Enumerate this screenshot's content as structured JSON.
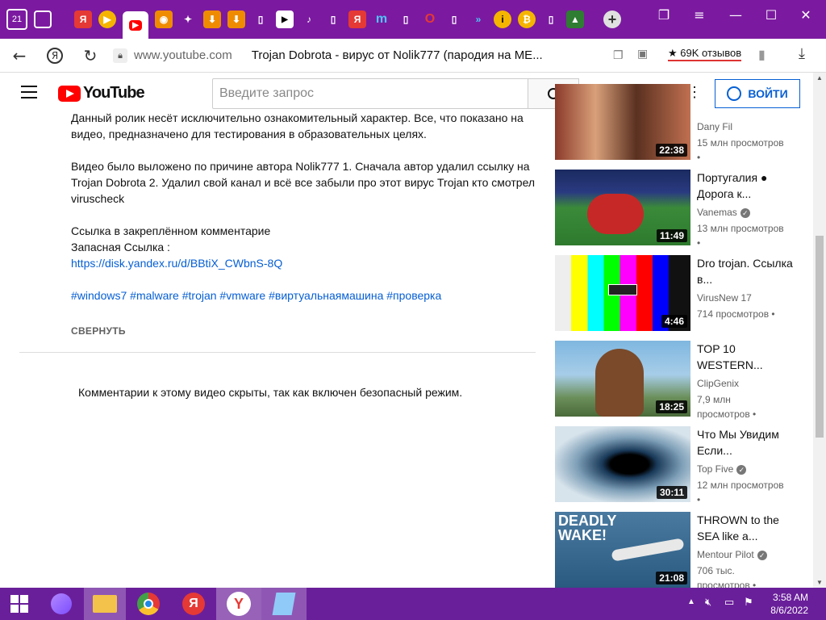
{
  "browser": {
    "tab_counter": "21",
    "url": "www.youtube.com",
    "page_title": "Trojan Dobrota - вирус от Nolik777 (пародия на ME...",
    "reviews": "69K отзывов",
    "accent": "#7b1aa0"
  },
  "youtube": {
    "logo_text": "YouTube",
    "search_placeholder": "Введите запрос",
    "signin_label": "ВОЙТИ"
  },
  "description": {
    "line1": "Данный ролик несёт исключительно ознакомительный характер. Все, что показано на видео, предназначено для тестирования в образовательных целях.",
    "line2": "Видео было выложено по причине автора Nolik777 1. Сначала автор удалил ссылку на Trojan Dobrota  2. Удалил свой канал и всё все забыли про этот вирус Trojan кто смотрел viruscheck",
    "link_label": "Ссылка в закреплённом комментарие",
    "backup_label": "Запасная Ссылка :",
    "link_url": "https://disk.yandex.ru/d/BBtiX_CWbnS-8Q",
    "hashtags": "#windows7 #malware #trojan #vmware #виртуальнаямашина #проверка",
    "collapse": "СВЕРНУТЬ"
  },
  "comments_notice": "Комментарии к этому видео скрыты, так как включен безопасный режим.",
  "recommendations": [
    {
      "title": "",
      "channel": "Dany Fil",
      "verified": false,
      "views": "15 млн просмотров •",
      "duration": "22:38"
    },
    {
      "title": "Португалия ● Дорога к...",
      "channel": "Vanemas",
      "verified": true,
      "views": "13 млн просмотров •",
      "duration": "11:49"
    },
    {
      "title": "Dro trojan. Ссылка в...",
      "channel": "VirusNew 17",
      "verified": false,
      "views": "714 просмотров •",
      "duration": "4:46"
    },
    {
      "title": "TOP 10 WESTERN...",
      "channel": "ClipGenix",
      "verified": false,
      "views": "7,9 млн просмотров •",
      "duration": "18:25"
    },
    {
      "title": "Что Мы Увидим Если...",
      "channel": "Top Five",
      "verified": true,
      "views": "12 млн просмотров •",
      "duration": "30:11"
    },
    {
      "title": "THROWN to the SEA like a...",
      "channel": "Mentour Pilot",
      "verified": true,
      "views": "706 тыс. просмотров •",
      "duration": "21:08"
    }
  ],
  "thumb_texts": {
    "deadly": "DEADLY WAKE!"
  },
  "taskbar": {
    "time": "3:58 AM",
    "date": "8/6/2022",
    "yandex_glyph": "Я"
  }
}
